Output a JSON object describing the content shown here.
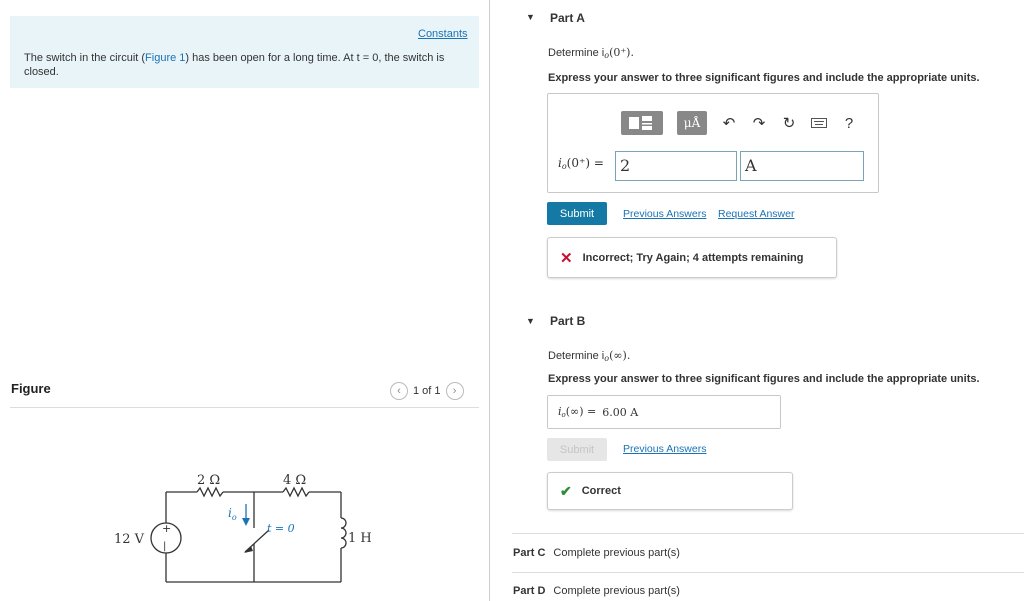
{
  "left": {
    "constants_link": "Constants",
    "problem_pre": "The switch in the circuit (",
    "problem_link": "Figure 1",
    "problem_post": ") has been open for a long time. At t = 0, the switch is closed.",
    "figure_label": "Figure",
    "pager_text": "1 of 1",
    "circuit": {
      "source_label": "12 V",
      "r1_label": "2 Ω",
      "r2_label": "4 Ω",
      "inductor_label": "1 H",
      "current_label": "i",
      "current_sub": "o",
      "switch_label": "t = 0"
    }
  },
  "part_a": {
    "title": "Part A",
    "question": "Determine i",
    "question_sub": "o",
    "question_arg": "(0⁺).",
    "instruction": "Express your answer to three significant figures and include the appropriate units.",
    "toolbar_units": "μÅ",
    "toolbar_help": "?",
    "field_label": "i",
    "field_sub": "o",
    "field_arg": "(0⁺) =",
    "value": "2",
    "unit": "A",
    "submit": "Submit",
    "previous_answers": "Previous Answers",
    "request_answer": "Request Answer",
    "feedback": "Incorrect; Try Again; 4 attempts remaining"
  },
  "part_b": {
    "title": "Part B",
    "question": "Determine i",
    "question_sub": "o",
    "question_arg": "(∞).",
    "instruction": "Express your answer to three significant figures and include the appropriate units.",
    "answer_label": "i",
    "answer_sub": "o",
    "answer_arg": "(∞) =",
    "answer_value": "6.00 A",
    "submit": "Submit",
    "previous_answers": "Previous Answers",
    "feedback": "Correct"
  },
  "part_c": {
    "title": "Part C",
    "status": "Complete previous part(s)"
  },
  "part_d": {
    "title": "Part D",
    "status": "Complete previous part(s)"
  }
}
